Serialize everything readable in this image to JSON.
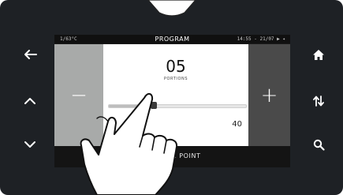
{
  "status_bar": {
    "left_text": "1/63°C",
    "title": "PROGRAM",
    "right_text": "14:55 - 21/07 ▶ ✦"
  },
  "stepper": {
    "value": "05",
    "label": "PORTIONS",
    "minus_label": "−",
    "plus_label": "+"
  },
  "slider": {
    "max_value": "40",
    "level_fraction": 0.33
  },
  "bottom_bar": {
    "label": "ORDER POINT"
  },
  "side_buttons": {
    "left": [
      "arrow-left-icon",
      "chevron-up-icon",
      "chevron-down-icon"
    ],
    "right": [
      "home-icon",
      "sort-arrows-icon",
      "search-icon"
    ]
  },
  "colors": {
    "device_body": "#1e2125",
    "minus_panel": "#a8aaa9",
    "plus_panel": "#4a4a4a",
    "content_bg": "#ffffff"
  }
}
